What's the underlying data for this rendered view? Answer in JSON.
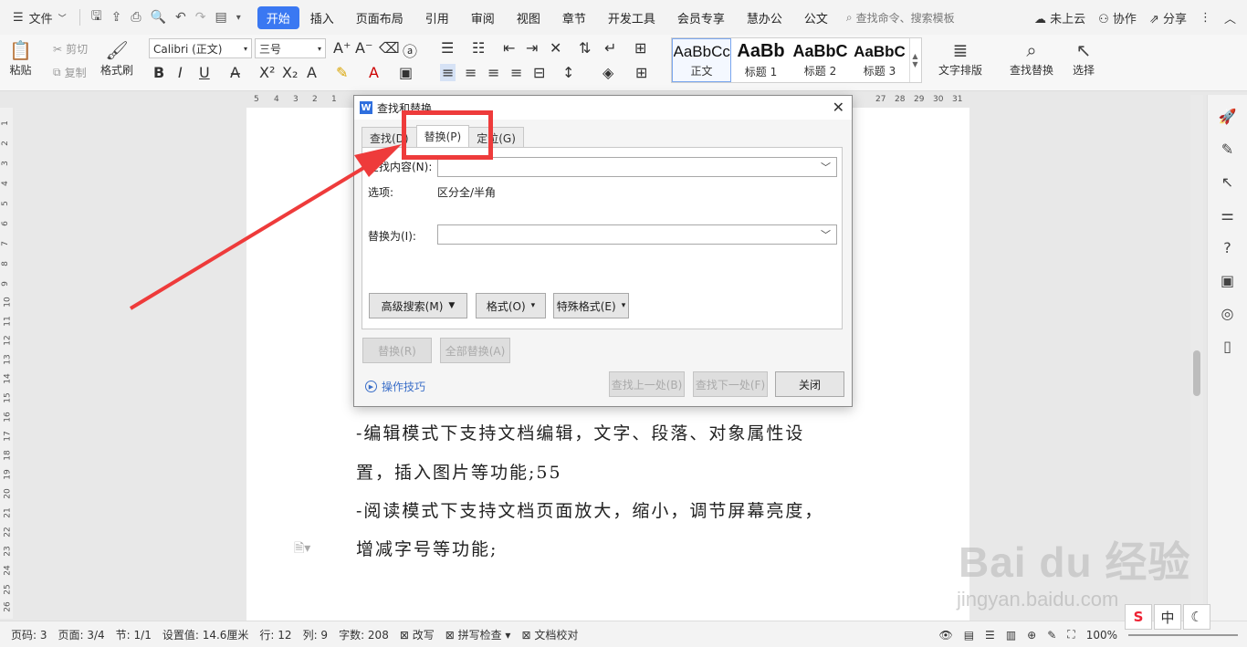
{
  "menubar": {
    "file": "文件",
    "tabs": [
      "开始",
      "插入",
      "页面布局",
      "引用",
      "审阅",
      "视图",
      "章节",
      "开发工具",
      "会员专享",
      "慧办公",
      "公文"
    ],
    "search_placeholder": "查找命令、搜索模板",
    "cloud": "未上云",
    "collab": "协作",
    "share": "分享"
  },
  "ribbon": {
    "paste": "粘贴",
    "cut": "剪切",
    "copy": "复制",
    "format_painter": "格式刷",
    "font_name": "Calibri (正文)",
    "font_size": "三号",
    "styles": [
      {
        "preview": "AaBbCcI",
        "name": "正文"
      },
      {
        "preview": "AaBb",
        "name": "标题 1"
      },
      {
        "preview": "AaBbC",
        "name": "标题 2"
      },
      {
        "preview": "AaBbC",
        "name": "标题 3"
      }
    ],
    "text_layout": "文字排版",
    "find_replace": "查找替换",
    "select": "选择"
  },
  "ruler": {
    "h": [
      "5",
      "4",
      "3",
      "2",
      "1",
      "27",
      "28",
      "29",
      "30",
      "31"
    ],
    "v": [
      "1",
      "2",
      "3",
      "4",
      "5",
      "6",
      "7",
      "8",
      "9",
      "10",
      "11",
      "12",
      "13",
      "14",
      "15",
      "16",
      "17",
      "18",
      "19",
      "20",
      "21",
      "22",
      "23",
      "24",
      "25",
      "26"
    ]
  },
  "document": {
    "lines": [
      "-编辑模式下支持文档编辑，文字、段落、对象属性设",
      "置，插入图片等功能;55",
      "-阅读模式下支持文档页面放大，缩小，调节屏幕亮度，",
      "增减字号等功能;"
    ]
  },
  "dialog": {
    "title": "查找和替换",
    "tabs": [
      "查找(D)",
      "替换(P)",
      "定位(G)"
    ],
    "find_label": "查找内容(N):",
    "find_value": "",
    "options_label": "选项:",
    "options_value": "区分全/半角",
    "replace_label": "替换为(I):",
    "replace_value": "",
    "advanced": "高级搜索(M)",
    "format": "格式(O)",
    "special": "特殊格式(E)",
    "replace_btn": "替换(R)",
    "replace_all": "全部替换(A)",
    "tips": "操作技巧",
    "find_prev": "查找上一处(B)",
    "find_next": "查找下一处(F)",
    "close": "关闭"
  },
  "statusbar": {
    "page_no": "页码: 3",
    "pages": "页面: 3/4",
    "section": "节: 1/1",
    "setting": "设置值: 14.6厘米",
    "row": "行: 12",
    "col": "列: 9",
    "words": "字数: 208",
    "revise": "改写",
    "spell": "拼写检查",
    "proof": "文档校对",
    "zoom": "100%"
  },
  "watermark": {
    "main": "Bai du 经验",
    "url": "jingyan.baidu.com"
  },
  "ime": {
    "zh": "中"
  },
  "colors": {
    "accent": "#3a78f2",
    "annotation": "#ee3b3b"
  }
}
